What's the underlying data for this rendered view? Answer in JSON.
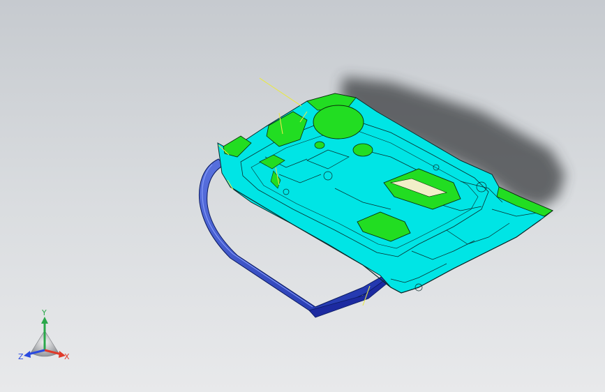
{
  "viewport": {
    "background_top": "#c6cacf",
    "background_bottom": "#e8e9eb"
  },
  "model": {
    "panel_color": "#00e5e5",
    "surface_highlight_color": "#22dd22",
    "edge_color": "#0a2a2a",
    "frame_color": "#2f49c8",
    "seal_color": "#c21fc2",
    "ref_line_color": "#e8e84a",
    "shadow_color": "#3a3c40"
  },
  "triad": {
    "x_label": "X",
    "y_label": "Y",
    "z_label": "Z",
    "x_color": "#e03a2a",
    "y_color": "#2aa84a",
    "z_color": "#2a4ae0"
  }
}
